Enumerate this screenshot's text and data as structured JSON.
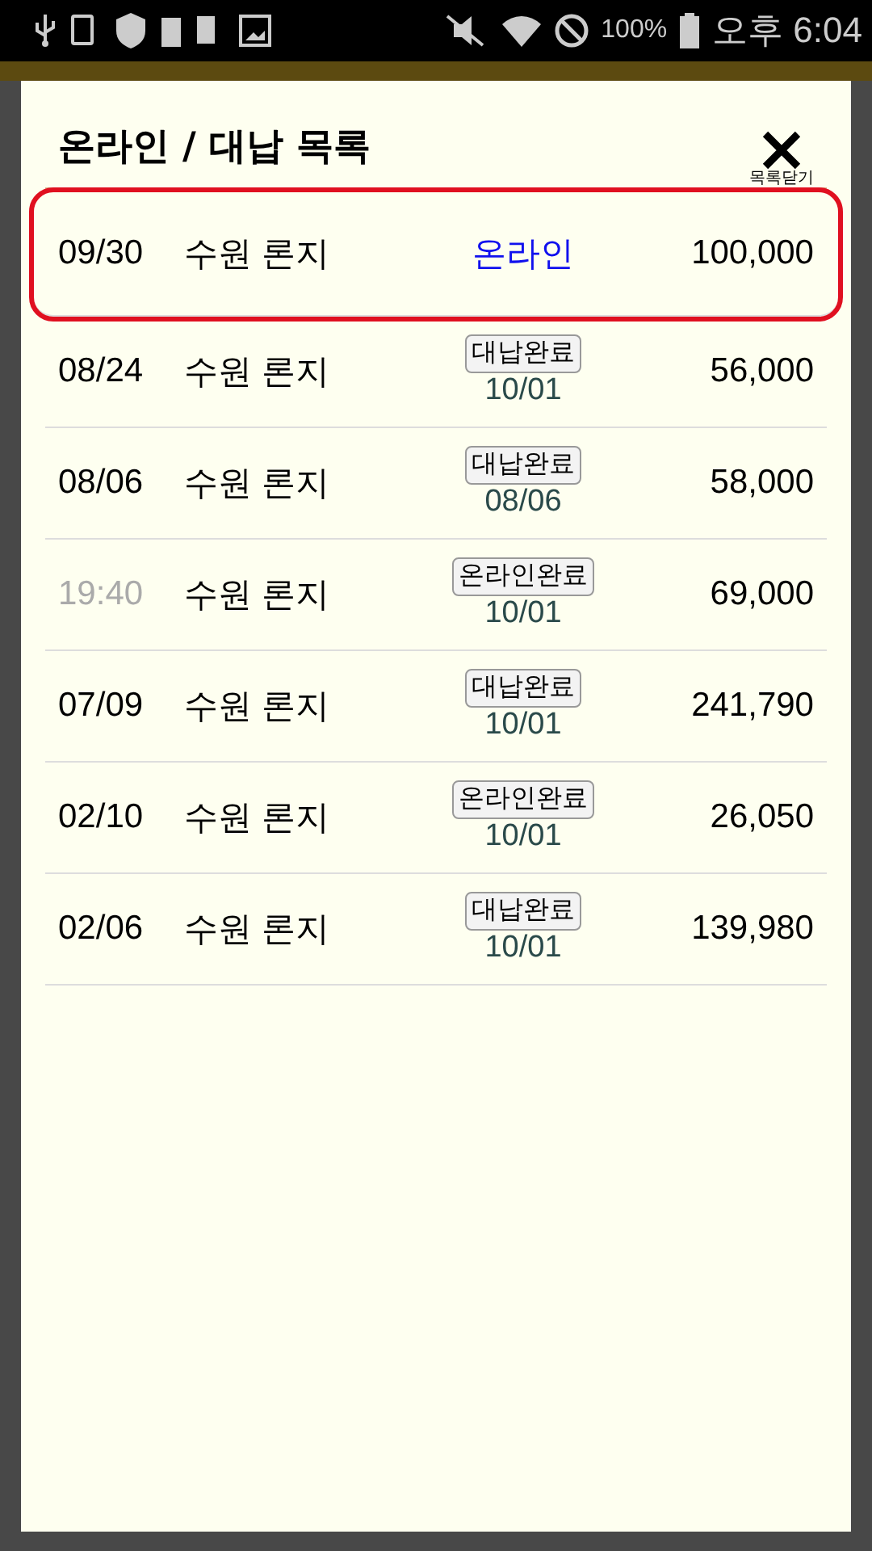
{
  "status_bar": {
    "battery": "100%",
    "time": "오후 6:04"
  },
  "dialog": {
    "title": "온라인 / 대납 목록",
    "close_label": "목록닫기",
    "rows": [
      {
        "kind": "online",
        "date": "09/30",
        "date_muted": false,
        "name": "수원 론지",
        "status": "온라인",
        "amount": "100,000",
        "highlighted": true
      },
      {
        "kind": "done",
        "date": "08/24",
        "date_muted": false,
        "name": "수원 론지",
        "status": "대납완료",
        "status_date": "10/01",
        "amount": "56,000",
        "highlighted": false
      },
      {
        "kind": "done",
        "date": "08/06",
        "date_muted": false,
        "name": "수원 론지",
        "status": "대납완료",
        "status_date": "08/06",
        "amount": "58,000",
        "highlighted": false
      },
      {
        "kind": "done",
        "date": "19:40",
        "date_muted": true,
        "name": "수원 론지",
        "status": "온라인완료",
        "status_date": "10/01",
        "amount": "69,000",
        "highlighted": false
      },
      {
        "kind": "done",
        "date": "07/09",
        "date_muted": false,
        "name": "수원 론지",
        "status": "대납완료",
        "status_date": "10/01",
        "amount": "241,790",
        "highlighted": false
      },
      {
        "kind": "done",
        "date": "02/10",
        "date_muted": false,
        "name": "수원 론지",
        "status": "온라인완료",
        "status_date": "10/01",
        "amount": "26,050",
        "highlighted": false
      },
      {
        "kind": "done",
        "date": "02/06",
        "date_muted": false,
        "name": "수원 론지",
        "status": "대납완료",
        "status_date": "10/01",
        "amount": "139,980",
        "highlighted": false
      }
    ]
  }
}
